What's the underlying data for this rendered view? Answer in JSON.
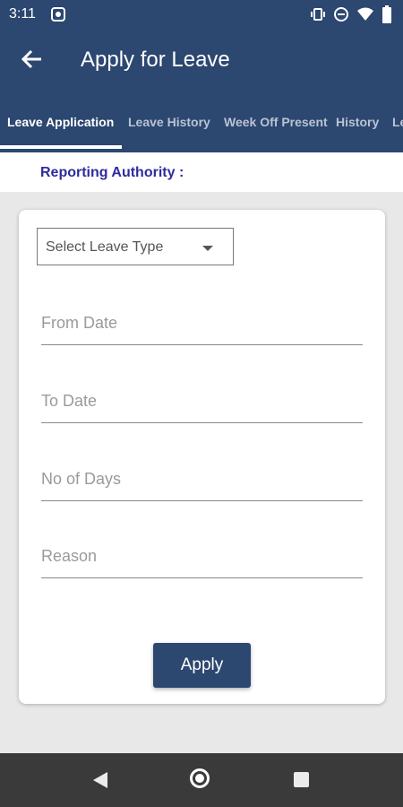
{
  "status_bar": {
    "time": "3:11"
  },
  "app_bar": {
    "title": "Apply for Leave"
  },
  "tabs": [
    {
      "label": "Leave Application"
    },
    {
      "label": "Leave History"
    },
    {
      "label": "Week Off Present"
    },
    {
      "label": "History"
    },
    {
      "label": "Le"
    }
  ],
  "reporting_authority": {
    "label": "Reporting Authority :"
  },
  "form": {
    "leave_type": {
      "selected": "Select Leave Type"
    },
    "from_date": {
      "placeholder": "From Date"
    },
    "to_date": {
      "placeholder": "To Date"
    },
    "no_of_days": {
      "placeholder": "No of Days"
    },
    "reason": {
      "placeholder": "Reason"
    },
    "apply_label": "Apply"
  },
  "colors": {
    "primary": "#2c4770",
    "reporting_text": "#2f2b9e"
  }
}
